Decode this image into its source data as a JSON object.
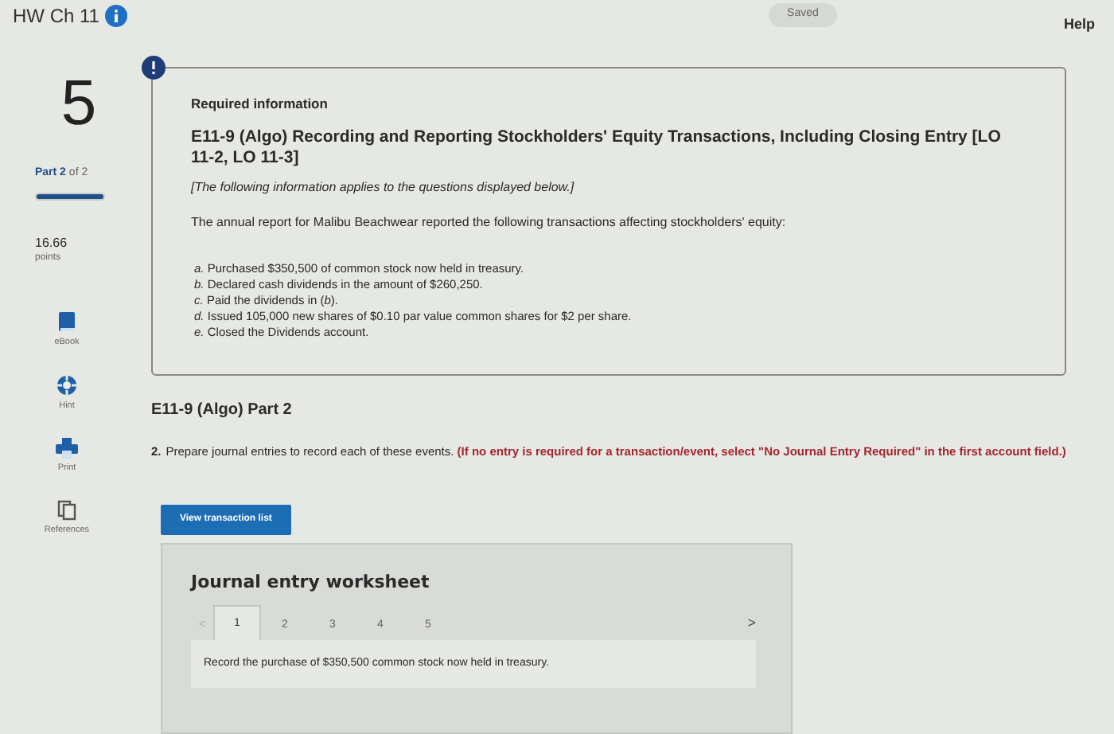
{
  "header": {
    "title": "HW Ch 11",
    "status": "Saved",
    "help": "Help"
  },
  "sidebar": {
    "question_number": "5",
    "part": "Part 2",
    "part_of": "of 2",
    "progress": {
      "level": 1
    },
    "score": "16.66",
    "score_unit": "points",
    "tools": [
      {
        "label": "eBook",
        "kind": "book"
      },
      {
        "label": "Hint",
        "kind": "hint"
      },
      {
        "label": "Print",
        "kind": "print"
      },
      {
        "label": "References",
        "kind": "references"
      }
    ]
  },
  "info_card": {
    "heading": "Required information",
    "title": "E11-9 (Algo) Recording and Reporting Stockholders' Equity Transactions, Including Closing Entry [LO 11-2, LO 11-3]",
    "note": "[The following information applies to the questions displayed below.]",
    "intro": "The annual report for Malibu Beachwear reported the following transactions affecting stockholders' equity:",
    "items": [
      {
        "label": "a.",
        "text": "Purchased $350,500 of common stock now held in treasury."
      },
      {
        "label": "b.",
        "text": "Declared cash dividends in the amount of $260,250."
      },
      {
        "label": "c.",
        "text": "Paid the dividends in (*b*)."
      },
      {
        "label": "d.",
        "text": "Issued 105,000 new shares of $0.10 par value common shares for $2 per share."
      },
      {
        "label": "e.",
        "text": "Closed the Dividends account."
      }
    ]
  },
  "part": {
    "title": "E11-9 (Algo) Part 2",
    "number": "2.",
    "instruction": "Prepare journal entries to record each of these events. **(If no entry is required for a transaction/event, select \"No Journal Entry Required\" in the first account field.)**",
    "button": "View transaction list"
  },
  "worksheet": {
    "title": "Journal entry worksheet",
    "prev": "<",
    "next": ">",
    "tabs": [
      {
        "label": "1",
        "selected": true
      },
      {
        "label": "2",
        "selected": false
      },
      {
        "label": "3",
        "selected": false
      },
      {
        "label": "4",
        "selected": false
      },
      {
        "label": "5",
        "selected": false
      }
    ],
    "prompt": "Record the purchase of $350,500 common stock now held in treasury."
  }
}
